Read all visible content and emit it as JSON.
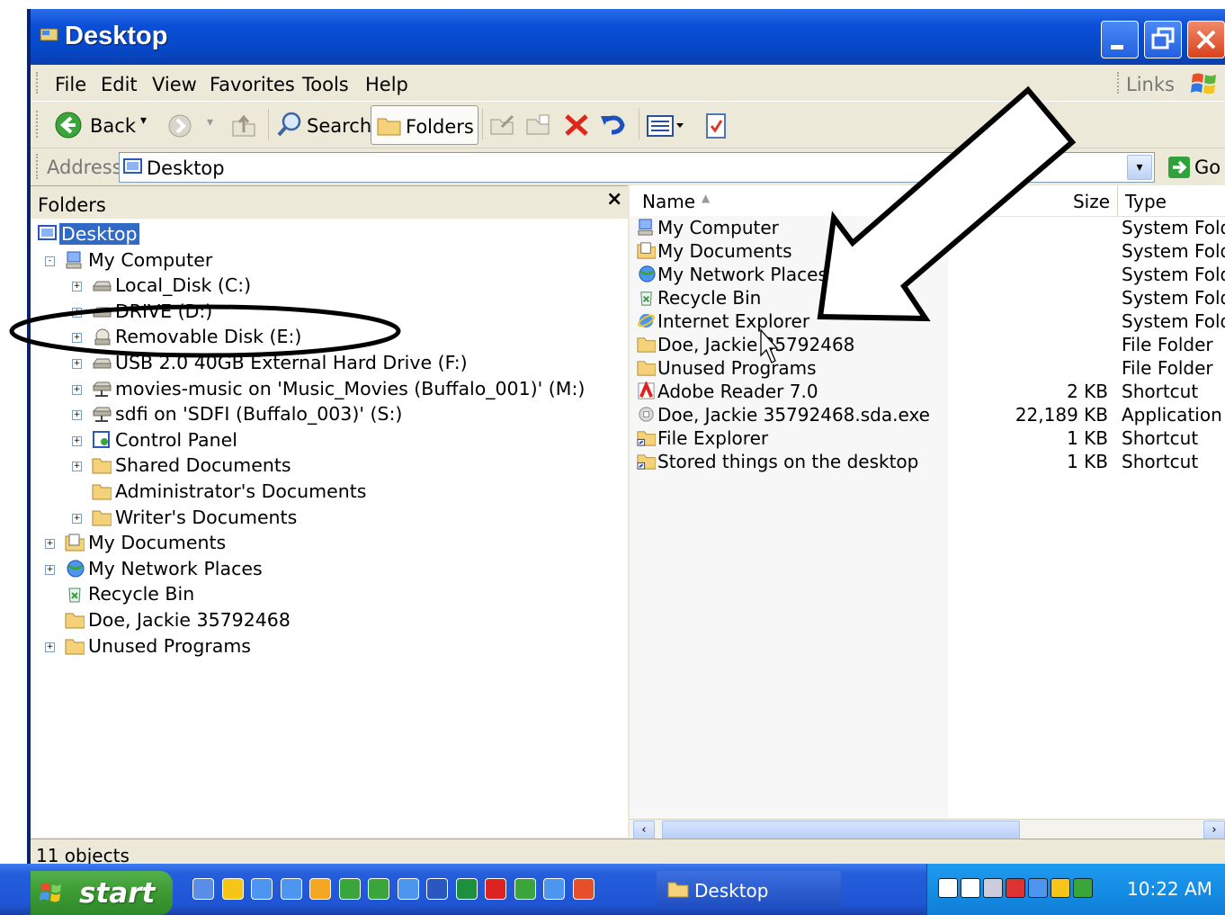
{
  "window": {
    "title": "Desktop"
  },
  "menu": [
    "File",
    "Edit",
    "View",
    "Favorites",
    "Tools",
    "Help"
  ],
  "links_label": "Links",
  "toolbar": {
    "back": "Back",
    "search": "Search",
    "folders": "Folders"
  },
  "address": {
    "label": "Address",
    "value": "Desktop",
    "go": "Go"
  },
  "folders_pane": {
    "title": "Folders",
    "close": "×",
    "tree": [
      {
        "label": "Desktop",
        "icon": "desktop-icon"
      },
      {
        "label": "My Computer",
        "icon": "computer-icon"
      },
      {
        "label": "Local_Disk (C:)",
        "icon": "drive-icon"
      },
      {
        "label": "DRIVE (D:)",
        "icon": "drive-icon"
      },
      {
        "label": "Removable Disk (E:)",
        "icon": "removable-disk-icon"
      },
      {
        "label": "USB 2.0 40GB External Hard Drive (F:)",
        "icon": "drive-icon"
      },
      {
        "label": "movies-music on 'Music_Movies (Buffalo_001)' (M:)",
        "icon": "network-drive-icon"
      },
      {
        "label": "sdfi on 'SDFI (Buffalo_003)' (S:)",
        "icon": "network-drive-icon"
      },
      {
        "label": "Control Panel",
        "icon": "control-panel-icon"
      },
      {
        "label": "Shared Documents",
        "icon": "folder-icon"
      },
      {
        "label": "Administrator's Documents",
        "icon": "folder-icon"
      },
      {
        "label": "Writer's Documents",
        "icon": "folder-icon"
      },
      {
        "label": "My Documents",
        "icon": "my-documents-icon"
      },
      {
        "label": "My Network Places",
        "icon": "network-places-icon"
      },
      {
        "label": "Recycle Bin",
        "icon": "recycle-bin-icon"
      },
      {
        "label": "Doe, Jackie 35792468",
        "icon": "folder-icon"
      },
      {
        "label": "Unused Programs",
        "icon": "folder-icon"
      }
    ]
  },
  "files": {
    "columns": {
      "name": "Name",
      "size": "Size",
      "type": "Type"
    },
    "rows": [
      {
        "name": "My Computer",
        "size": "",
        "type": "System Folder",
        "icon": "computer-icon"
      },
      {
        "name": "My Documents",
        "size": "",
        "type": "System Folder",
        "icon": "my-documents-icon"
      },
      {
        "name": "My Network Places",
        "size": "",
        "type": "System Folder",
        "icon": "network-places-icon"
      },
      {
        "name": "Recycle Bin",
        "size": "",
        "type": "System Folder",
        "icon": "recycle-bin-icon"
      },
      {
        "name": "Internet Explorer",
        "size": "",
        "type": "System Folder",
        "icon": "internet-explorer-icon"
      },
      {
        "name": "Doe, Jackie 35792468",
        "size": "",
        "type": "File Folder",
        "icon": "folder-icon"
      },
      {
        "name": "Unused Programs",
        "size": "",
        "type": "File Folder",
        "icon": "folder-icon"
      },
      {
        "name": "Adobe Reader 7.0",
        "size": "2 KB",
        "type": "Shortcut",
        "icon": "adobe-reader-icon"
      },
      {
        "name": "Doe, Jackie 35792468.sda.exe",
        "size": "22,189 KB",
        "type": "Application",
        "icon": "application-icon"
      },
      {
        "name": "File Explorer",
        "size": "1 KB",
        "type": "Shortcut",
        "icon": "shortcut-folder-icon"
      },
      {
        "name": "Stored things on the desktop",
        "size": "1 KB",
        "type": "Shortcut",
        "icon": "shortcut-folder-icon"
      }
    ]
  },
  "status": {
    "text": "11 objects"
  },
  "taskbar": {
    "start": "start",
    "task": "Desktop",
    "clock": "10:22 AM"
  },
  "colors": {
    "titlebar": "#0B4FD8",
    "start": "#3C9A33",
    "chrome": "#ECE9D8",
    "selection": "#316AC5"
  }
}
